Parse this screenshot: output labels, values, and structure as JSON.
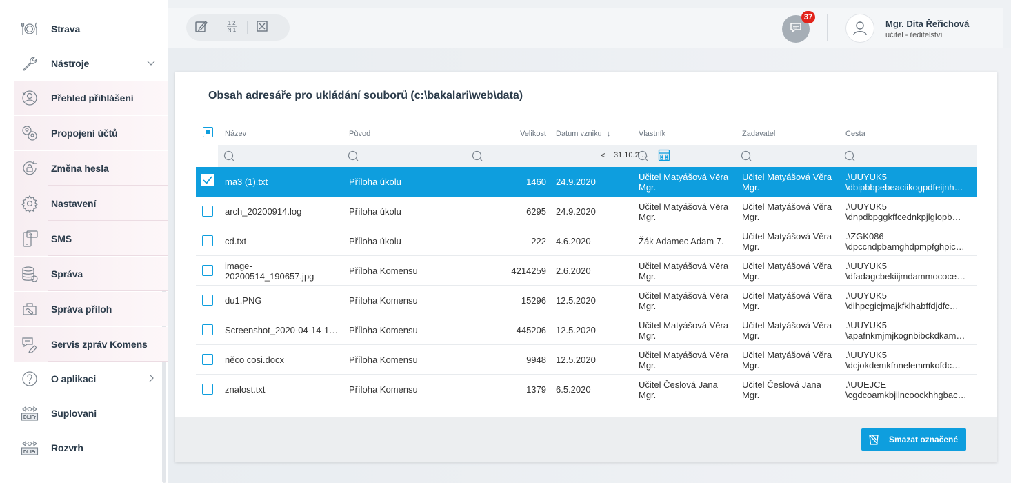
{
  "sidebar": {
    "items": [
      {
        "label": "Strava",
        "icon": "food-icon",
        "chevron": ""
      },
      {
        "label": "Nástroje",
        "icon": "wrench-icon",
        "chevron": "down"
      },
      {
        "label": "Přehled přihlášení",
        "icon": "login-overview-icon",
        "chevron": ""
      },
      {
        "label": "Propojení účtů",
        "icon": "linked-accounts-icon",
        "chevron": ""
      },
      {
        "label": "Změna hesla",
        "icon": "password-change-icon",
        "chevron": ""
      },
      {
        "label": "Nastavení",
        "icon": "gear-icon",
        "chevron": ""
      },
      {
        "label": "SMS",
        "icon": "sms-icon",
        "chevron": ""
      },
      {
        "label": "Správa",
        "icon": "database-icon",
        "chevron": ""
      },
      {
        "label": "Správa příloh",
        "icon": "attachments-icon",
        "chevron": ""
      },
      {
        "label": "Servis zpráv Komens",
        "icon": "messages-service-icon",
        "chevron": ""
      },
      {
        "label": "O aplikaci",
        "icon": "help-icon",
        "chevron": "right"
      },
      {
        "label": "Suplovani",
        "icon": "dlifr-icon",
        "chevron": ""
      },
      {
        "label": "Rozvrh",
        "icon": "dlifr-icon",
        "chevron": ""
      }
    ],
    "dlifr_text": "DLIFr"
  },
  "header": {
    "tools": [
      "edit-icon",
      "numbering-icon",
      "close-box-icon"
    ],
    "numbering_top": "1 2",
    "numbering_bottom": "N 1",
    "notifications_count": "37",
    "user_name": "Mgr. Dita Řeřichová",
    "user_role": "učitel - ředitelství"
  },
  "panel": {
    "title": "Obsah adresáře pro ukládání souborů (c:\\bakalari\\web\\data)",
    "columns": {
      "name": "Název",
      "origin": "Původ",
      "size": "Velikost",
      "created": "Datum vzniku",
      "owner": "Vlastník",
      "creator": "Zadavatel",
      "path": "Cesta"
    },
    "date_filter_prefix": "<",
    "date_filter_value": "31.10.2 …",
    "delete_button": "Smazat označené",
    "colors": {
      "accent": "#0e9ede",
      "badge": "#e2231a"
    }
  },
  "rows": [
    {
      "name": [
        "ma3 (1).txt"
      ],
      "origin": "Příloha úkolu",
      "size": "1460",
      "date": "24.9.2020",
      "owner": [
        "Učitel Matyášová Věra",
        "Mgr."
      ],
      "creator": [
        "Učitel Matyášová Věra",
        "Mgr."
      ],
      "path": [
        ".\\UUYUK5",
        "\\dbipbbpebeaciikogpdfeijnh…"
      ],
      "selected": true
    },
    {
      "name": [
        "arch_20200914.log"
      ],
      "origin": "Příloha úkolu",
      "size": "6295",
      "date": "24.9.2020",
      "owner": [
        "Učitel Matyášová Věra",
        "Mgr."
      ],
      "creator": [
        "Učitel Matyášová Věra",
        "Mgr."
      ],
      "path": [
        ".\\UUYUK5",
        "\\dnpdbpggkffcednkpjlglopb…"
      ],
      "selected": false
    },
    {
      "name": [
        "cd.txt"
      ],
      "origin": "Příloha úkolu",
      "size": "222",
      "date": "4.6.2020",
      "owner": [
        "Žák Adamec Adam 7."
      ],
      "creator": [
        "Učitel Matyášová Věra",
        "Mgr."
      ],
      "path": [
        ".\\ZGK086",
        "\\dpccndpbamghdpmpfghpic…"
      ],
      "selected": false
    },
    {
      "name": [
        "image-",
        "20200514_190657.jpg"
      ],
      "origin": "Příloha Komensu",
      "size": "4214259",
      "date": "2.6.2020",
      "owner": [
        "Učitel Matyášová Věra",
        "Mgr."
      ],
      "creator": [
        "Učitel Matyášová Věra",
        "Mgr."
      ],
      "path": [
        ".\\UUYUK5",
        "\\dfadagcbekiijmdammococe…"
      ],
      "selected": false
    },
    {
      "name": [
        "du1.PNG"
      ],
      "origin": "Příloha Komensu",
      "size": "15296",
      "date": "12.5.2020",
      "owner": [
        "Učitel Matyášová Věra",
        "Mgr."
      ],
      "creator": [
        "Učitel Matyášová Věra",
        "Mgr."
      ],
      "path": [
        ".\\UUYUK5",
        "\\dihpcgicjmajkfklhabffdjdfc…"
      ],
      "selected": false
    },
    {
      "name": [
        "Screenshot_2020-04-14-1…"
      ],
      "origin": "Příloha Komensu",
      "size": "445206",
      "date": "12.5.2020",
      "owner": [
        "Učitel Matyášová Věra",
        "Mgr."
      ],
      "creator": [
        "Učitel Matyášová Věra",
        "Mgr."
      ],
      "path": [
        ".\\UUYUK5",
        "\\apafnkmjmjkognbibckdkam…"
      ],
      "selected": false
    },
    {
      "name": [
        "něco cosi.docx"
      ],
      "origin": "Příloha Komensu",
      "size": "9948",
      "date": "12.5.2020",
      "owner": [
        "Učitel Matyášová Věra",
        "Mgr."
      ],
      "creator": [
        "Učitel Matyášová Věra",
        "Mgr."
      ],
      "path": [
        ".\\UUYUK5",
        "\\dcjokdemkfnnelemmkofdc…"
      ],
      "selected": false
    },
    {
      "name": [
        "znalost.txt"
      ],
      "origin": "Příloha Komensu",
      "size": "1379",
      "date": "6.5.2020",
      "owner": [
        "Učitel Česlová Jana",
        "Mgr."
      ],
      "creator": [
        "Učitel Česlová Jana",
        "Mgr."
      ],
      "path": [
        ".\\UUEJCE",
        "\\cgdcoamkbjilncoockhhgbac…"
      ],
      "selected": false
    }
  ]
}
